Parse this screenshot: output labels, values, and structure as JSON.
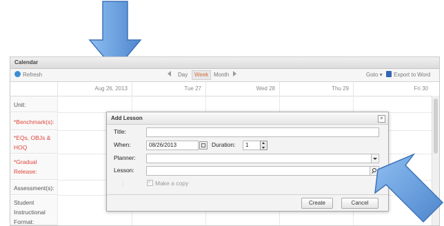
{
  "panel": {
    "title": "Calendar"
  },
  "toolbar": {
    "refresh": "Refresh",
    "day": "Day",
    "week": "Week",
    "month": "Month",
    "goto": "Goto ▾",
    "export": "Export to Word"
  },
  "calendar": {
    "days": [
      "Aug 26, 2013",
      "Tue 27",
      "Wed 28",
      "Thu 29",
      "Fri 30"
    ],
    "rows": [
      {
        "label": "Unit:",
        "highlight": false
      },
      {
        "label": "*Benchmark(s):",
        "highlight": true
      },
      {
        "label": "*EQs, OBJs & HOQ",
        "highlight": true
      },
      {
        "label": "*Gradual Release:",
        "highlight": true
      },
      {
        "label": "Assessment(s):",
        "highlight": false
      },
      {
        "label": "Student Instructional Format:",
        "highlight": false
      }
    ]
  },
  "dialog": {
    "title": "Add Lesson",
    "close": "×",
    "title_label": "Title:",
    "title_value": "",
    "when_label": "When:",
    "when_value": "08/26/2013",
    "duration_label": "Duration:",
    "duration_value": "1",
    "planner_label": "Planner:",
    "planner_value": "",
    "lesson_label": "Lesson:",
    "lesson_value": "",
    "colon": ":",
    "copy_label": "Make a copy",
    "create": "Create",
    "cancel": "Cancel"
  },
  "colors": {
    "arrow": "#6ea3e0",
    "accent": "#e0453b"
  }
}
